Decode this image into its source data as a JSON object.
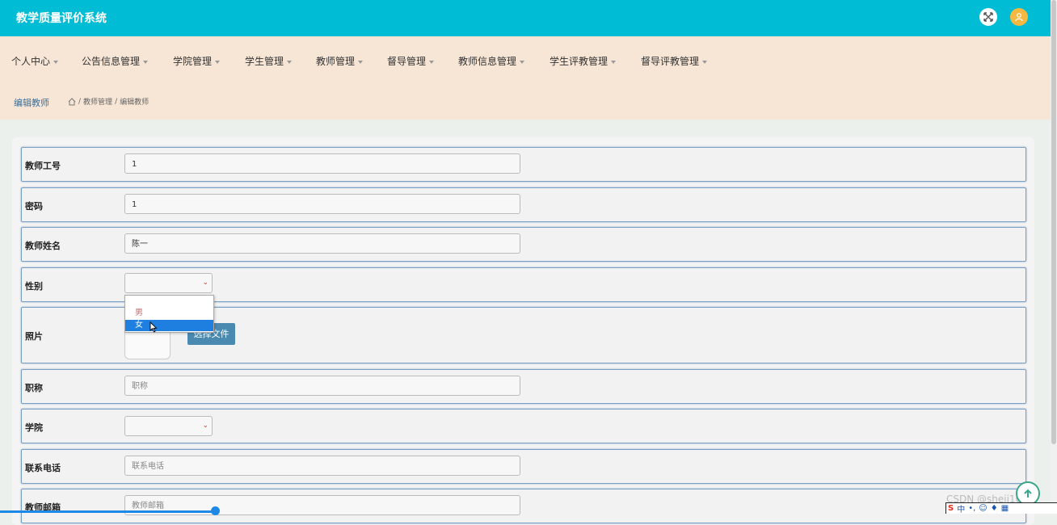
{
  "app": {
    "title": "教学质量评价系统"
  },
  "nav": {
    "items": [
      "个人中心",
      "公告信息管理",
      "学院管理",
      "学生管理",
      "教师管理",
      "督导管理",
      "教师信息管理",
      "学生评教管理",
      "督导评教管理"
    ]
  },
  "breadcrumb": {
    "title": "编辑教师",
    "path": [
      "教师管理",
      "编辑教师"
    ],
    "separator": "/"
  },
  "form": {
    "teacher_id": {
      "label": "教师工号",
      "value": "1"
    },
    "password": {
      "label": "密码",
      "value": "1"
    },
    "teacher_name": {
      "label": "教师姓名",
      "value": "陈一"
    },
    "gender": {
      "label": "性别",
      "value": "",
      "options": [
        "男",
        "女"
      ],
      "highlighted": "女"
    },
    "photo": {
      "label": "照片",
      "button_label": "选择文件"
    },
    "title": {
      "label": "职称",
      "placeholder": "职称"
    },
    "college": {
      "label": "学院",
      "value": ""
    },
    "phone": {
      "label": "联系电话",
      "placeholder": "联系电话"
    },
    "email": {
      "label": "教师邮箱",
      "placeholder": "教师邮箱"
    }
  },
  "watermark": "CSDN @sheji1011",
  "tray": {
    "ime_label": "中"
  },
  "colors": {
    "header": "#00bcd4",
    "nav_bg": "#f7e6d6",
    "highlight": "#1e7fe0",
    "upload_button": "#4a8ab0"
  },
  "icons": {
    "expand": "expand-arrows-icon",
    "user": "user-icon",
    "home": "home-icon",
    "top": "arrow-up-icon"
  }
}
